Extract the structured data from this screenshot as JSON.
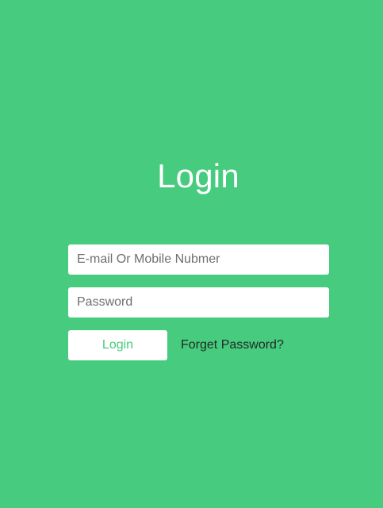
{
  "colors": {
    "background": "#47CB7E",
    "panel": "#FFFFFF",
    "button_text": "#47CB7E"
  },
  "login_form": {
    "title": "Login",
    "email": {
      "value": "",
      "placeholder": "E-mail Or Mobile Nubmer"
    },
    "password": {
      "value": "",
      "placeholder": "Password"
    },
    "submit_label": "Login",
    "forgot_label": "Forget Password?"
  }
}
